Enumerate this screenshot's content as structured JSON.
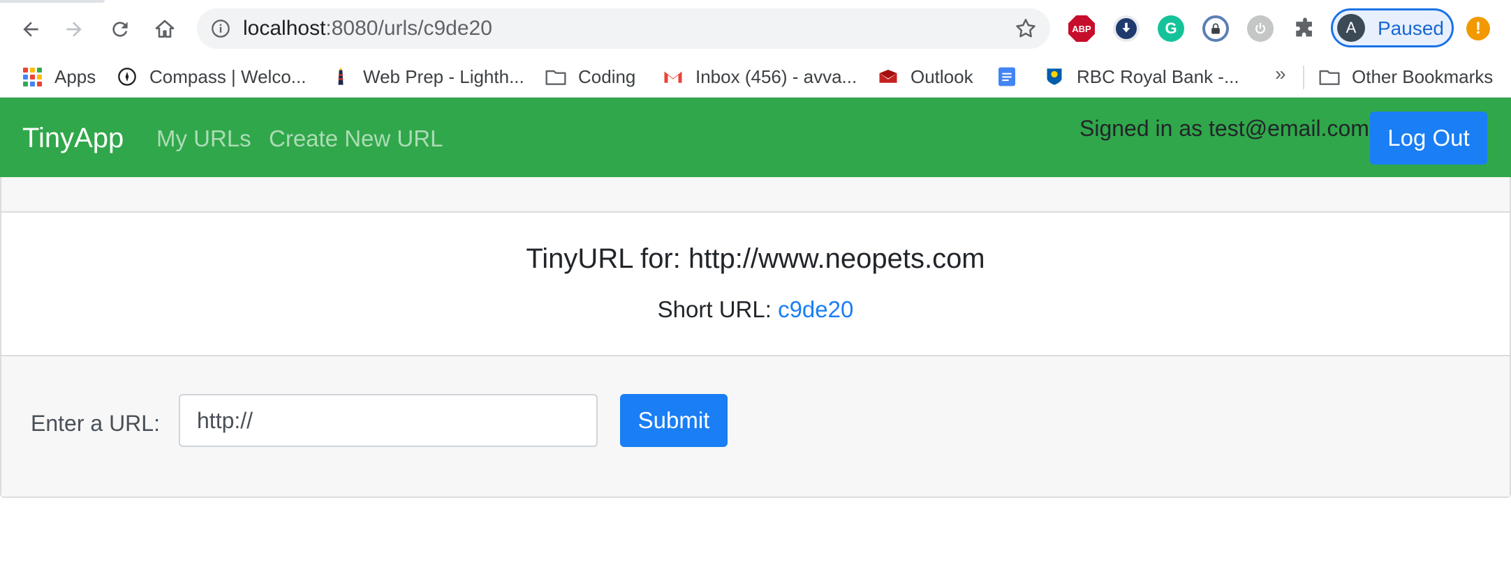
{
  "browser": {
    "url_host": "localhost",
    "url_rest": ":8080/urls/c9de20",
    "profile": {
      "initial": "A",
      "label": "Paused"
    },
    "extensions": {
      "abp_text": "ABP",
      "grammarly_text": "G",
      "alert_text": "!"
    }
  },
  "bookmarks": {
    "items": [
      {
        "label": "Apps",
        "icon": "apps-grid-icon"
      },
      {
        "label": "Compass | Welco...",
        "icon": "compass-icon"
      },
      {
        "label": "Web Prep - Lighth...",
        "icon": "lighthouse-icon"
      },
      {
        "label": "Coding",
        "icon": "folder-icon"
      },
      {
        "label": "Inbox (456) - avva...",
        "icon": "gmail-icon"
      },
      {
        "label": "Outlook",
        "icon": "outlook-icon"
      },
      {
        "label": "",
        "icon": "google-docs-icon"
      },
      {
        "label": "RBC Royal Bank -...",
        "icon": "rbc-icon"
      }
    ],
    "overflow_label": "»",
    "other": "Other Bookmarks"
  },
  "navbar": {
    "brand": "TinyApp",
    "links": [
      "My URLs",
      "Create New URL"
    ],
    "signed_in": "Signed in as test@email.com",
    "logout": "Log Out"
  },
  "card": {
    "title": "TinyURL for: http://www.neopets.com",
    "short_label": "Short URL: ",
    "short_value": "c9de20",
    "form": {
      "label": "Enter a URL:",
      "placeholder": "http://",
      "submit": "Submit"
    }
  },
  "colors": {
    "navbar": "#30a74a",
    "primary": "#1a7ef5",
    "card_bg": "#f7f7f7"
  }
}
